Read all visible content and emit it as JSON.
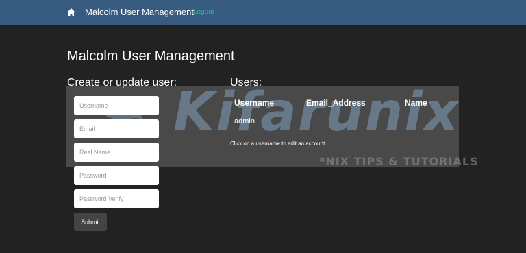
{
  "navbar": {
    "brand": "Malcolm User Management",
    "logout": "Logout",
    "home_icon": "home-icon"
  },
  "page": {
    "title": "Malcolm User Management"
  },
  "create_form": {
    "title": "Create or update user:",
    "username_placeholder": "Username",
    "email_placeholder": "Email",
    "realname_placeholder": "Real Name",
    "password_placeholder": "Password",
    "password_verify_placeholder": "Password Verify",
    "submit_label": "Submit"
  },
  "users": {
    "title": "Users:",
    "columns": [
      "Username",
      "Email_Address",
      "Name"
    ],
    "rows": [
      {
        "username": "admin",
        "email": "",
        "name": ""
      }
    ],
    "hint": "Click on a username to edit an account."
  },
  "watermark": {
    "text": "Kifarunix",
    "subtext": "*NIX TIPS & TUTORIALS"
  },
  "colors": {
    "navbar": "#375a7f",
    "background": "#222222",
    "link": "#12c0b0"
  }
}
